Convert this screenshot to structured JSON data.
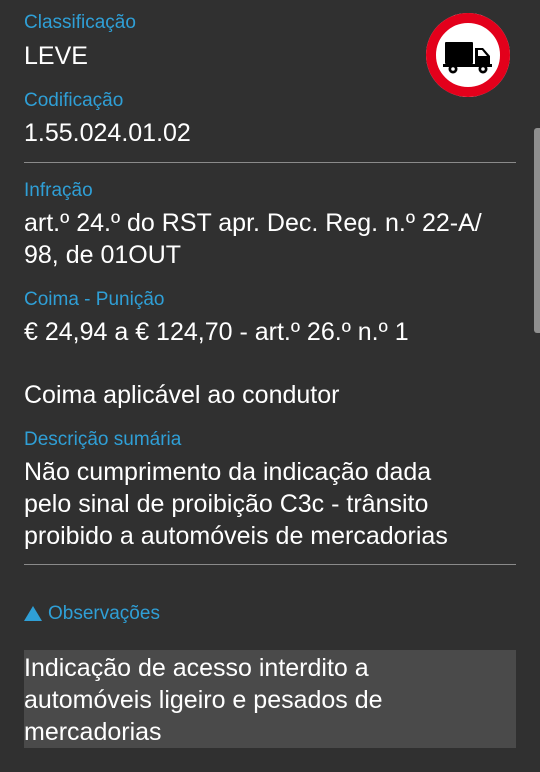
{
  "classificacao": {
    "label": "Classificação",
    "value": "LEVE"
  },
  "codificacao": {
    "label": "Codificação",
    "value": "1.55.024.01.02"
  },
  "sign": {
    "icon": "truck-prohibition-sign-icon",
    "ring_color": "#e3001b",
    "fill_color": "#ffffff",
    "truck_color": "#000000"
  },
  "infracao": {
    "label": "Infração",
    "line1": "art.º 24.º do RST apr. Dec. Reg. n.º 22-A/",
    "line2": "98, de 01OUT"
  },
  "coima": {
    "label": "Coima - Punição",
    "value": "€ 24,94 a € 124,70 - art.º 26.º n.º 1",
    "applicable": "Coima aplicável ao condutor"
  },
  "descricao": {
    "label": "Descrição sumária",
    "line1": "Não cumprimento da indicação dada",
    "line2": "pelo sinal de proibição C3c - trânsito",
    "line3": "proibido a automóveis de mercadorias"
  },
  "observacoes": {
    "label": "Observações",
    "line1": "Indicação de acesso interdito a",
    "line2": "automóveis ligeiro e pesados de",
    "line3": "mercadorias"
  },
  "colors": {
    "accent": "#2f9fd6",
    "background": "#303030",
    "panel": "#4a4a4a"
  }
}
